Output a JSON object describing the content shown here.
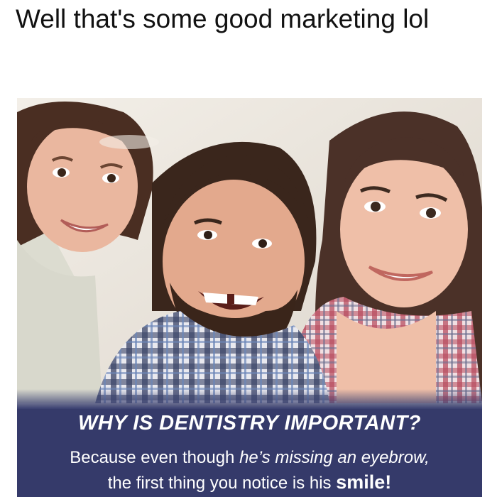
{
  "post": {
    "caption": "Well that's some good marketing lol"
  },
  "ad": {
    "headline": "WHY IS DENTISTRY IMPORTANT?",
    "body_part1": "Because even though ",
    "body_part2": "he’s missing an eyebrow,",
    "body_part3": "the first thing you notice is his ",
    "body_part4": "smile!",
    "banner_color": "#353a6a",
    "photo_description_icon": "family-photo"
  }
}
